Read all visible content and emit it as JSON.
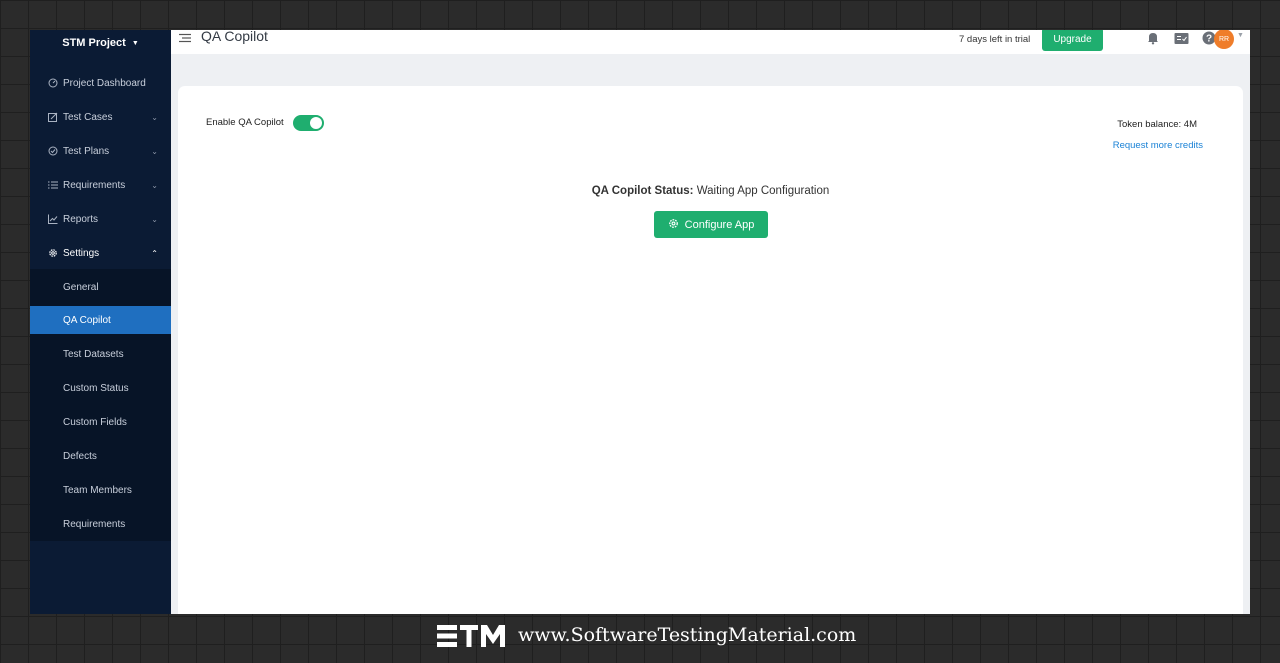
{
  "sidebar": {
    "project": "STM Project",
    "items": [
      {
        "label": "Project Dashboard",
        "icon": "dashboard-icon"
      },
      {
        "label": "Test Cases",
        "icon": "edit-icon"
      },
      {
        "label": "Test Plans",
        "icon": "check-circle-icon"
      },
      {
        "label": "Requirements",
        "icon": "list-icon"
      },
      {
        "label": "Reports",
        "icon": "chart-icon"
      },
      {
        "label": "Settings",
        "icon": "gear-icon"
      }
    ],
    "settings_items": [
      "General",
      "QA Copilot",
      "Test Datasets",
      "Custom Status",
      "Custom Fields",
      "Defects",
      "Team Members",
      "Requirements"
    ],
    "active_item": "QA Copilot"
  },
  "header": {
    "title": "QA Copilot",
    "trial_text": "7 days left in trial",
    "upgrade_label": "Upgrade",
    "avatar_initials": "RR"
  },
  "main": {
    "enable_label": "Enable QA Copilot",
    "enabled": true,
    "token_balance": "Token balance: 4M",
    "request_credits": "Request more credits",
    "status_label": "QA Copilot Status:",
    "status_value": " Waiting App Configuration",
    "configure_label": "Configure App"
  },
  "footer": {
    "site": "www.SoftwareTestingMaterial.com"
  },
  "colors": {
    "sidebar_bg": "#0b1b34",
    "active_bg": "#1f6fc0",
    "accent_green": "#1fae6f",
    "link_blue": "#1a82d6",
    "avatar_orange": "#ef7d2a"
  }
}
